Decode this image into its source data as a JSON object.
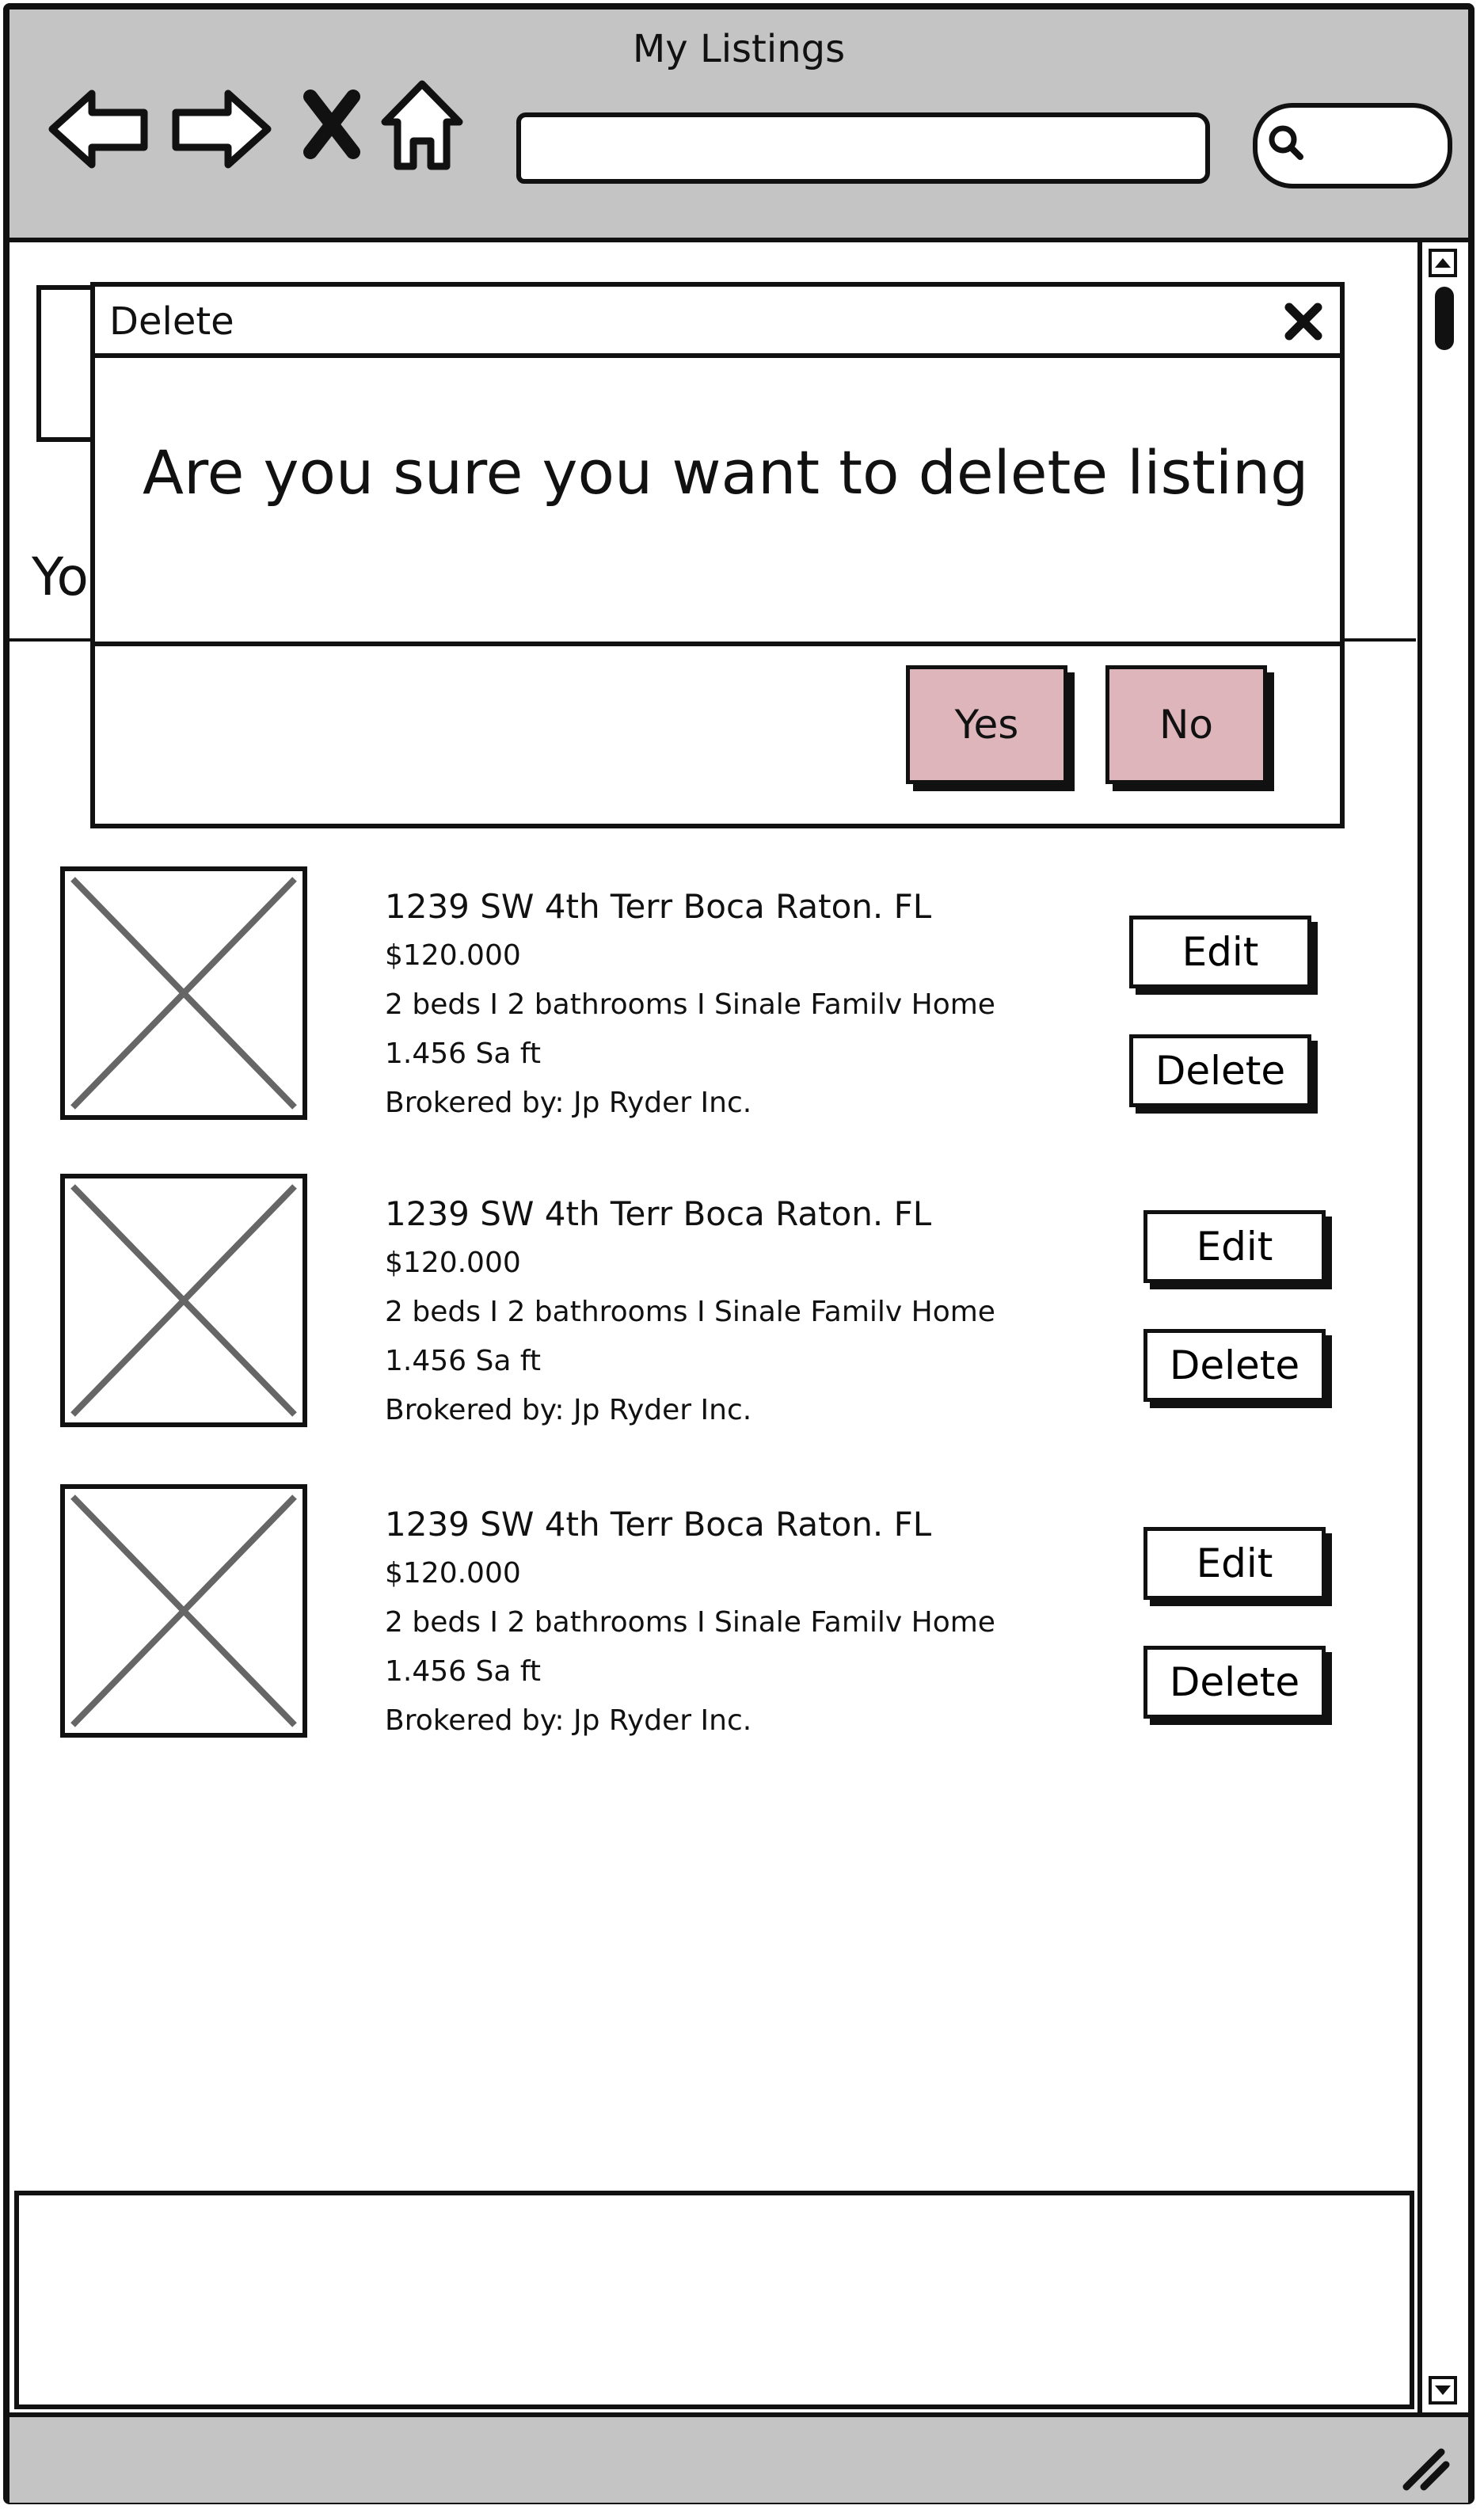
{
  "window": {
    "title": "My Listings"
  },
  "page": {
    "heading_partial": "Yo"
  },
  "listings": [
    {
      "address": "1239 SW 4th Terr Boca Raton. FL",
      "price": "$120.000",
      "details": "2 beds I 2 bathrooms I Sinale Familv Home",
      "area": "1.456 Sa ft",
      "broker": "Brokered by: Jp Ryder Inc.",
      "edit_label": "Edit",
      "delete_label": "Delete"
    },
    {
      "address": "1239 SW 4th Terr Boca Raton. FL",
      "price": "$120.000",
      "details": "2 beds I 2 bathrooms I Sinale Familv Home",
      "area": "1.456 Sa ft",
      "broker": "Brokered by: Jp Ryder Inc.",
      "edit_label": "Edit",
      "delete_label": "Delete"
    },
    {
      "address": "1239 SW 4th Terr Boca Raton. FL",
      "price": "$120.000",
      "details": "2 beds I 2 bathrooms I Sinale Familv Home",
      "area": "1.456 Sa ft",
      "broker": "Brokered by: Jp Ryder Inc.",
      "edit_label": "Edit",
      "delete_label": "Delete"
    }
  ],
  "dialog": {
    "title": "Delete",
    "message": "Are you sure you want to delete listing",
    "yes_label": "Yes",
    "no_label": "No",
    "button_color": "#ddb5bb"
  },
  "chrome_color": "#c4c4c4"
}
